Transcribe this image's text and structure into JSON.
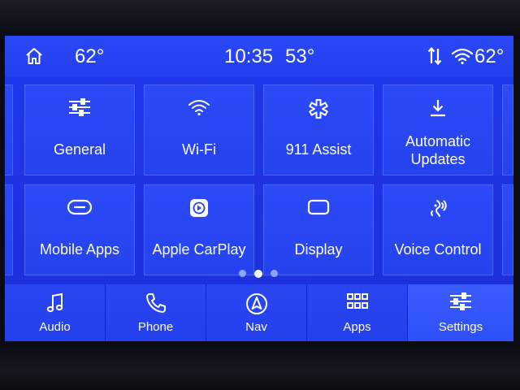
{
  "status_bar": {
    "temp_left": "62°",
    "time": "10:35",
    "temp_center": "53°",
    "temp_right": "62°",
    "icons": [
      "home-icon",
      "sync-arrows-icon",
      "wifi-signal-icon"
    ]
  },
  "settings_grid": {
    "tiles": [
      {
        "label": "General",
        "icon": "sliders-icon"
      },
      {
        "label": "Wi-Fi",
        "icon": "wifi-icon"
      },
      {
        "label": "911 Assist",
        "icon": "medical-star-icon"
      },
      {
        "label": "Automatic Updates",
        "line1": "Automatic",
        "line2": "Updates",
        "icon": "download-icon"
      },
      {
        "label": "Mobile Apps",
        "icon": "link-pill-icon"
      },
      {
        "label": "Apple CarPlay",
        "icon": "carplay-icon"
      },
      {
        "label": "Display",
        "icon": "display-icon"
      },
      {
        "label": "Voice Control",
        "icon": "voice-icon"
      }
    ]
  },
  "pagination": {
    "pages": 3,
    "active": 2
  },
  "nav_bar": {
    "items": [
      {
        "label": "Audio",
        "icon": "music-note-icon"
      },
      {
        "label": "Phone",
        "icon": "phone-icon"
      },
      {
        "label": "Nav",
        "icon": "navigation-icon"
      },
      {
        "label": "Apps",
        "icon": "apps-grid-icon"
      },
      {
        "label": "Settings",
        "icon": "settings-sliders-icon",
        "active": true
      }
    ]
  },
  "colors": {
    "screen_blue": "#1e34e6",
    "tile_blue": "#2a46f4",
    "active_nav": "#3a5cff",
    "text": "#ffffff"
  }
}
